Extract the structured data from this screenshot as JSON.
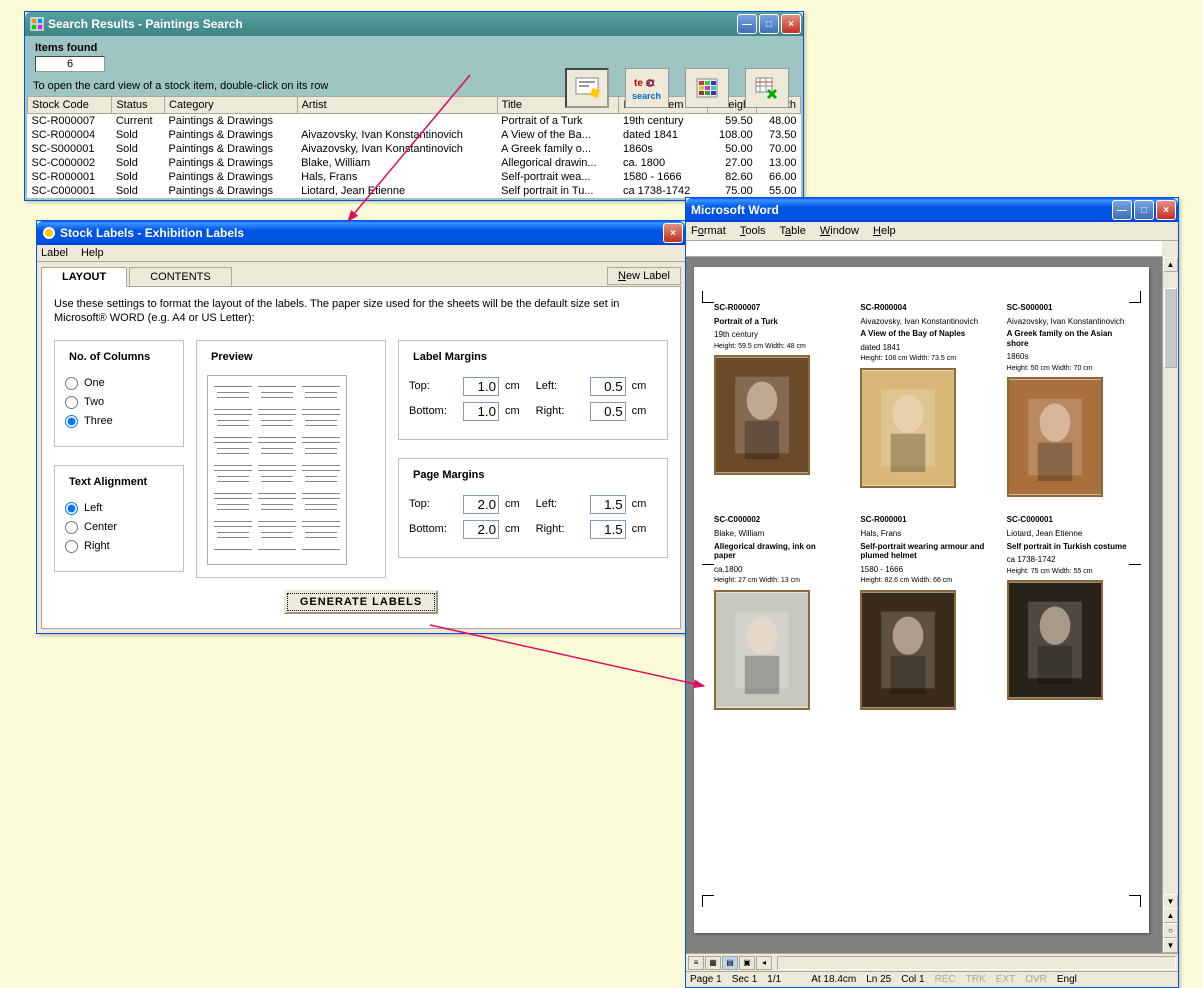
{
  "search": {
    "title": "Search Results - Paintings Search",
    "items_found_label": "Items found",
    "items_found": "6",
    "hint": "To open the card view of a stock item, double-click on its row",
    "columns": [
      "Stock Code",
      "Status",
      "Category",
      "Artist",
      "Title",
      "Date of Item",
      "Height",
      "Width"
    ],
    "rows": [
      {
        "code": "SC-R000007",
        "status": "Current",
        "cat": "Paintings & Drawings",
        "artist": "",
        "title": "Portrait of a Turk",
        "date": "19th century",
        "h": "59.50",
        "w": "48.00"
      },
      {
        "code": "SC-R000004",
        "status": "Sold",
        "cat": "Paintings & Drawings",
        "artist": "Aivazovsky, Ivan Konstantinovich",
        "title": "A View of the Ba...",
        "date": "dated 1841",
        "h": "108.00",
        "w": "73.50"
      },
      {
        "code": "SC-S000001",
        "status": "Sold",
        "cat": "Paintings & Drawings",
        "artist": "Aivazovsky, Ivan Konstantinovich",
        "title": "A Greek family o...",
        "date": "1860s",
        "h": "50.00",
        "w": "70.00"
      },
      {
        "code": "SC-C000002",
        "status": "Sold",
        "cat": "Paintings & Drawings",
        "artist": "Blake, William",
        "title": "Allegorical drawin...",
        "date": "ca. 1800",
        "h": "27.00",
        "w": "13.00"
      },
      {
        "code": "SC-R000001",
        "status": "Sold",
        "cat": "Paintings & Drawings",
        "artist": "Hals, Frans",
        "title": "Self-portrait wea...",
        "date": "1580 - 1666",
        "h": "82.60",
        "w": "66.00"
      },
      {
        "code": "SC-C000001",
        "status": "Sold",
        "cat": "Paintings & Drawings",
        "artist": "Liotard, Jean Etienne",
        "title": "Self portrait in Tu...",
        "date": "ca 1738-1742",
        "h": "75.00",
        "w": "55.00"
      }
    ]
  },
  "labels": {
    "title": "Stock Labels - Exhibition Labels",
    "menu": {
      "label": "Label",
      "help": "Help"
    },
    "tabs": {
      "layout": "LAYOUT",
      "contents": "CONTENTS"
    },
    "new_label": "New Label",
    "instructions": "Use these settings to format the layout of the labels.  The paper size used for the sheets will be the default size set in Microsoft® WORD (e.g. A4 or US Letter):",
    "cols_legend": "No. of Columns",
    "cols": {
      "one": "One",
      "two": "Two",
      "three": "Three"
    },
    "align_legend": "Text Alignment",
    "align": {
      "left": "Left",
      "center": "Center",
      "right": "Right"
    },
    "preview_legend": "Preview",
    "label_margins": "Label Margins",
    "page_margins": "Page Margins",
    "top": "Top:",
    "bottom": "Bottom:",
    "left": "Left:",
    "right": "Right:",
    "cm": "cm",
    "lm": {
      "top": "1.0",
      "bottom": "1.0",
      "left": "0.5",
      "right": "0.5"
    },
    "pm": {
      "top": "2.0",
      "bottom": "2.0",
      "left": "1.5",
      "right": "1.5"
    },
    "generate": "GENERATE LABELS"
  },
  "word": {
    "title": "Microsoft Word",
    "menu": {
      "format": "Format",
      "tools": "Tools",
      "table": "Table",
      "window": "Window",
      "help": "Help"
    },
    "status": {
      "page": "Page  1",
      "sec": "Sec  1",
      "pages": "1/1",
      "at": "At  18.4cm",
      "ln": "Ln  25",
      "col": "Col  1",
      "rec": "REC",
      "trk": "TRK",
      "ext": "EXT",
      "ovr": "OVR",
      "lang": "Engl"
    },
    "cards": [
      {
        "code": "SC-R000007",
        "artist": "",
        "title": "Portrait of a Turk",
        "date": "19th century",
        "dims": "Height:  59.5 cm    Width:  48 cm",
        "fill": "#6b4a2a"
      },
      {
        "code": "SC-R000004",
        "artist": "Aivazovsky, Ivan Konstantinovich",
        "title": "A View of the Bay of Naples",
        "date": "dated 1841",
        "dims": "Height:  108 cm    Width:  73.5 cm",
        "fill": "#d9b777"
      },
      {
        "code": "SC-S000001",
        "artist": "Aivazovsky, Ivan Konstantinovich",
        "title": "A Greek family on the Asian shore",
        "date": "1860s",
        "dims": "Height:  50 cm    Width:  70 cm",
        "fill": "#a96f3d"
      },
      {
        "code": "SC-C000002",
        "artist": "Blake, William",
        "title": "Allegorical drawing, ink on paper",
        "date": "ca.1800",
        "dims": "Height:  27 cm    Width:  13 cm",
        "fill": "#c8c8c0"
      },
      {
        "code": "SC-R000001",
        "artist": "Hals, Frans",
        "title": "Self-portrait wearing armour and plumed helmet",
        "date": "1580 - 1666",
        "dims": "Height:  82.6 cm    Width:  66 cm",
        "fill": "#3a2b1a"
      },
      {
        "code": "SC-C000001",
        "artist": "Liotard, Jean Etienne",
        "title": "Self portrait in Turkish costume",
        "date": "ca 1738-1742",
        "dims": "Height:  75 cm    Width:  55 cm",
        "fill": "#2a2218"
      }
    ]
  }
}
